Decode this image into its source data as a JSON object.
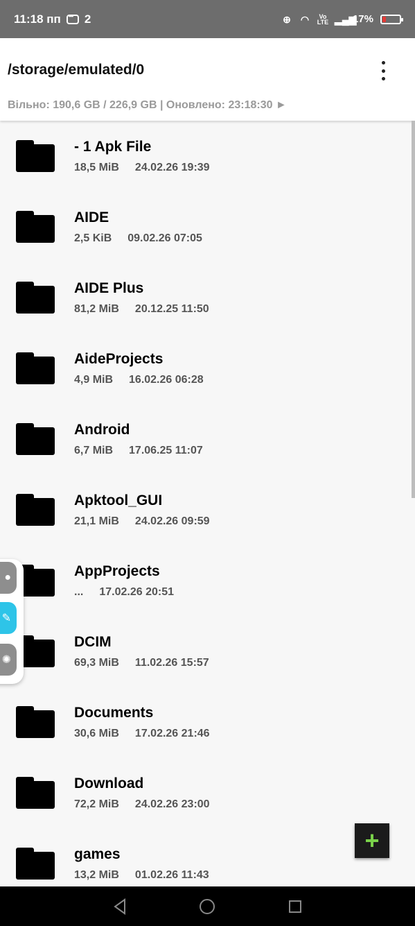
{
  "status_bar": {
    "time": "11:18 пп",
    "notification_count": "2",
    "battery": "17%"
  },
  "header": {
    "path": "/storage/emulated/0",
    "storage_info": "Вільно: 190,6 GB / 226,9 GB | Оновлено: 23:18:30 ►"
  },
  "files": [
    {
      "name": "- 1 Apk File",
      "size": "18,5 MiB",
      "date": "24.02.26 19:39"
    },
    {
      "name": "AIDE",
      "size": "2,5 KiB",
      "date": "09.02.26 07:05"
    },
    {
      "name": "AIDE Plus",
      "size": "81,2 MiB",
      "date": "20.12.25 11:50"
    },
    {
      "name": "AideProjects",
      "size": "4,9 MiB",
      "date": "16.02.26 06:28"
    },
    {
      "name": "Android",
      "size": "6,7 MiB",
      "date": "17.06.25 11:07"
    },
    {
      "name": "Apktool_GUI",
      "size": "21,1 MiB",
      "date": "24.02.26 09:59"
    },
    {
      "name": "AppProjects",
      "size": "...",
      "date": "17.02.26 20:51"
    },
    {
      "name": "DCIM",
      "size": "69,3 MiB",
      "date": "11.02.26 15:57"
    },
    {
      "name": "Documents",
      "size": "30,6 MiB",
      "date": "17.02.26 21:46"
    },
    {
      "name": "Download",
      "size": "72,2 MiB",
      "date": "24.02.26 23:00"
    },
    {
      "name": "games",
      "size": "13,2 MiB",
      "date": "01.02.26 11:43"
    }
  ],
  "icons": {
    "folder": "folder-icon",
    "fab": "plus-icon",
    "menu": "more-vert-icon"
  },
  "colors": {
    "fab_plus": "#7ad14a",
    "battery_low": "#e53935",
    "accent_panel": "#2ec4e8"
  }
}
